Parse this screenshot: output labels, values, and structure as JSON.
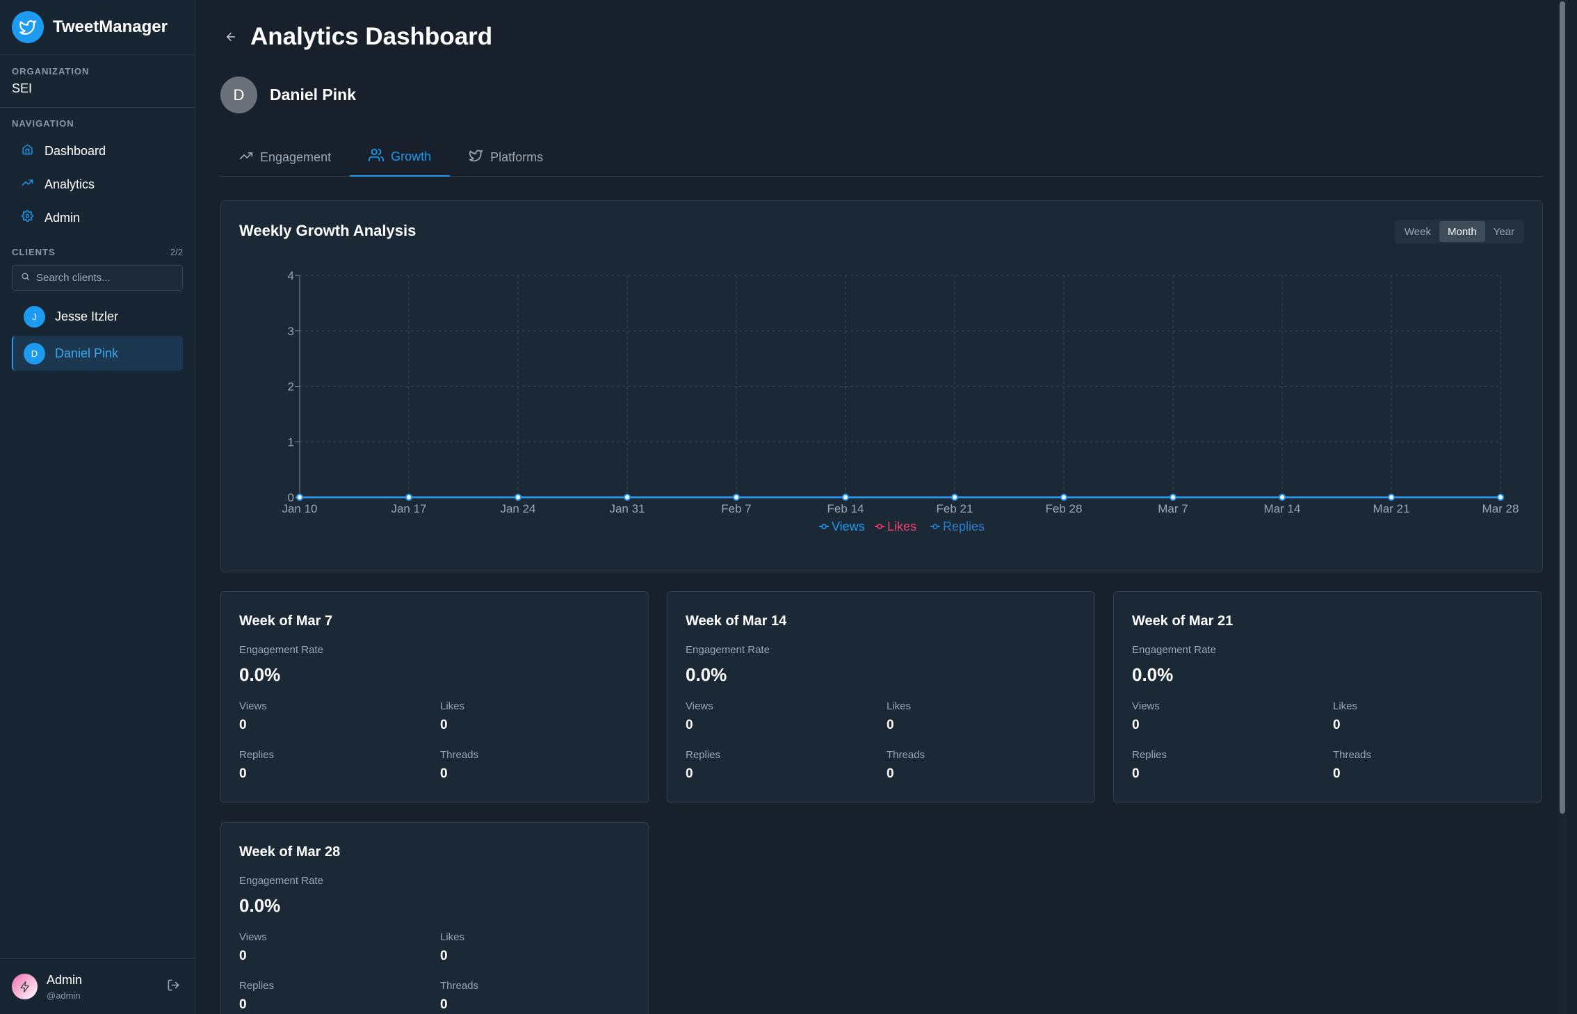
{
  "app": {
    "name": "TweetManager"
  },
  "organization": {
    "label": "ORGANIZATION",
    "value": "SEI"
  },
  "navigation": {
    "label": "NAVIGATION",
    "items": [
      {
        "label": "Dashboard",
        "icon": "home-icon"
      },
      {
        "label": "Analytics",
        "icon": "trending-up-icon"
      },
      {
        "label": "Admin",
        "icon": "gear-icon"
      }
    ]
  },
  "clients": {
    "label": "CLIENTS",
    "count": "2/2",
    "search_placeholder": "Search clients...",
    "items": [
      {
        "initial": "J",
        "name": "Jesse Itzler",
        "active": false
      },
      {
        "initial": "D",
        "name": "Daniel Pink",
        "active": true
      }
    ]
  },
  "user": {
    "name": "Admin",
    "handle": "@admin"
  },
  "header": {
    "title": "Analytics Dashboard"
  },
  "profile": {
    "initial": "D",
    "name": "Daniel Pink"
  },
  "tabs": [
    {
      "label": "Engagement",
      "icon": "trending-up-icon",
      "active": false
    },
    {
      "label": "Growth",
      "icon": "users-icon",
      "active": true
    },
    {
      "label": "Platforms",
      "icon": "twitter-icon",
      "active": false
    }
  ],
  "range": {
    "options": [
      "Week",
      "Month",
      "Year"
    ],
    "selected": "Month"
  },
  "colors": {
    "accent": "#1d9bf0",
    "views": "#1d9bf0",
    "likes": "#f0406a",
    "replies": "#2a7fd0"
  },
  "chart_data": {
    "type": "line",
    "title": "Weekly Growth Analysis",
    "x": [
      "Jan 10",
      "Jan 17",
      "Jan 24",
      "Jan 31",
      "Feb 7",
      "Feb 14",
      "Feb 21",
      "Feb 28",
      "Mar 7",
      "Mar 14",
      "Mar 21",
      "Mar 28"
    ],
    "series": [
      {
        "name": "Views",
        "values": [
          0,
          0,
          0,
          0,
          0,
          0,
          0,
          0,
          0,
          0,
          0,
          0
        ]
      },
      {
        "name": "Likes",
        "values": [
          0,
          0,
          0,
          0,
          0,
          0,
          0,
          0,
          0,
          0,
          0,
          0
        ]
      },
      {
        "name": "Replies",
        "values": [
          0,
          0,
          0,
          0,
          0,
          0,
          0,
          0,
          0,
          0,
          0,
          0
        ]
      }
    ],
    "yticks": [
      "0",
      "1",
      "2",
      "3",
      "4"
    ],
    "ylim": [
      0,
      4
    ],
    "grid": true,
    "legend": "bottom-center"
  },
  "weeks": [
    {
      "title": "Week of Mar 7",
      "rate_label": "Engagement Rate",
      "rate": "0.0%",
      "views_label": "Views",
      "views": "0",
      "likes_label": "Likes",
      "likes": "0",
      "replies_label": "Replies",
      "replies": "0",
      "threads_label": "Threads",
      "threads": "0"
    },
    {
      "title": "Week of Mar 14",
      "rate_label": "Engagement Rate",
      "rate": "0.0%",
      "views_label": "Views",
      "views": "0",
      "likes_label": "Likes",
      "likes": "0",
      "replies_label": "Replies",
      "replies": "0",
      "threads_label": "Threads",
      "threads": "0"
    },
    {
      "title": "Week of Mar 21",
      "rate_label": "Engagement Rate",
      "rate": "0.0%",
      "views_label": "Views",
      "views": "0",
      "likes_label": "Likes",
      "likes": "0",
      "replies_label": "Replies",
      "replies": "0",
      "threads_label": "Threads",
      "threads": "0"
    },
    {
      "title": "Week of Mar 28",
      "rate_label": "Engagement Rate",
      "rate": "0.0%",
      "views_label": "Views",
      "views": "0",
      "likes_label": "Likes",
      "likes": "0",
      "replies_label": "Replies",
      "replies": "0",
      "threads_label": "Threads",
      "threads": "0"
    }
  ]
}
